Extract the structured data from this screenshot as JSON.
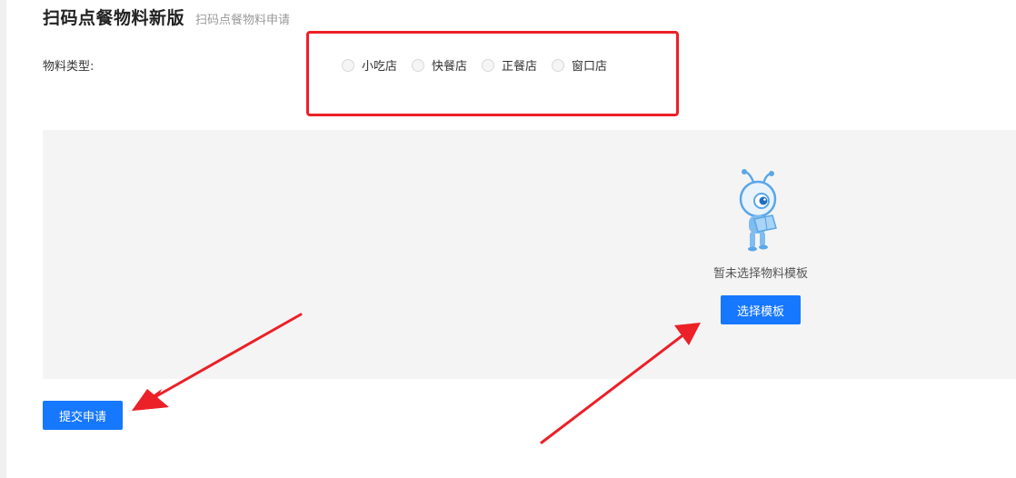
{
  "header": {
    "title": "扫码点餐物料新版",
    "subtitle": "扫码点餐物料申请"
  },
  "form": {
    "material_type_label": "物料类型:",
    "options": [
      {
        "label": "小吃店",
        "selected": false
      },
      {
        "label": "快餐店",
        "selected": false
      },
      {
        "label": "正餐店",
        "selected": false
      },
      {
        "label": "窗口店",
        "selected": false
      }
    ]
  },
  "template_panel": {
    "empty_text": "暂未选择物料模板",
    "select_button_label": "选择模板"
  },
  "actions": {
    "submit_label": "提交申请"
  },
  "colors": {
    "primary": "#1677ff",
    "annotation_red": "#ec2027",
    "panel_bg": "#f4f4f4"
  }
}
